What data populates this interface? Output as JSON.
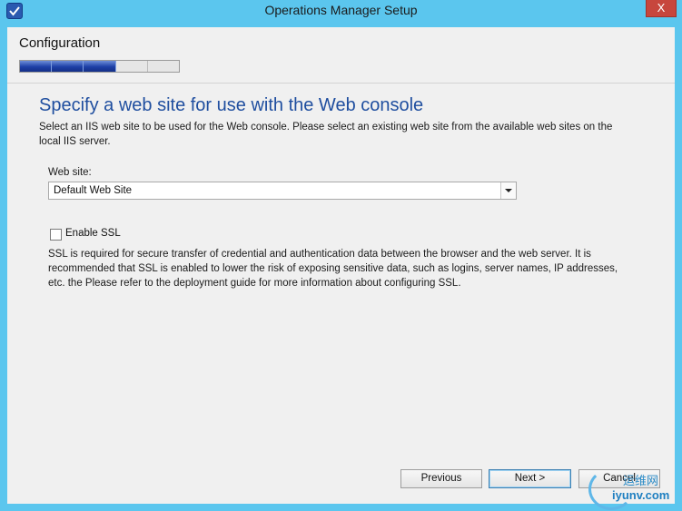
{
  "window": {
    "title": "Operations Manager Setup",
    "close_glyph": "X"
  },
  "header": {
    "stage_title": "Configuration",
    "progress": {
      "total_steps": 5,
      "completed_steps": 3
    }
  },
  "page": {
    "heading": "Specify a web site for use with the Web console",
    "description": "Select an IIS web site to be used for the Web console. Please select an existing web site from the available web sites on the local IIS server."
  },
  "website": {
    "label": "Web site:",
    "selected": "Default Web Site"
  },
  "ssl": {
    "label": "Enable SSL",
    "checked": false,
    "description": "SSL is required for secure transfer of credential and authentication data between the browser and the web server. It is recommended that SSL is enabled to lower the risk of exposing sensitive data, such as logins, server names, IP addresses, etc. the Please refer to the deployment guide for more information about configuring SSL."
  },
  "buttons": {
    "previous": "Previous",
    "next": "Next >",
    "cancel": "Cancel"
  },
  "watermark": {
    "cn": "运维网",
    "url": "iyunv.com"
  },
  "colors": {
    "titlebar": "#5bc6ee",
    "heading": "#1f4e9f",
    "progress_fill": "#1d3fa6",
    "close": "#c7463d"
  }
}
